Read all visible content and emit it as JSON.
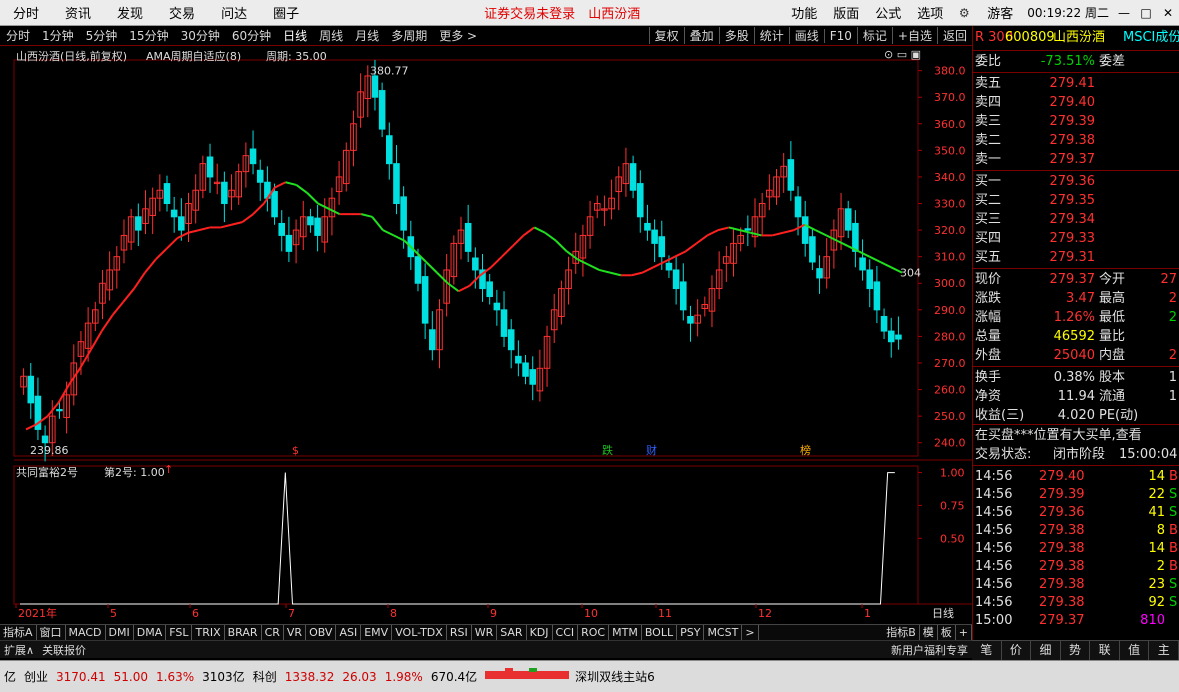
{
  "menu": {
    "items": [
      "分时",
      "资讯",
      "发现",
      "交易",
      "问达",
      "圈子"
    ],
    "notice": "证券交易未登录",
    "stock_name": "山西汾酒",
    "right_items": [
      "功能",
      "版面",
      "公式",
      "选项"
    ],
    "user": "游客",
    "clock": "00:19:22 周二"
  },
  "toolbar": {
    "periods": [
      "分时",
      "1分钟",
      "5分钟",
      "15分钟",
      "30分钟",
      "60分钟",
      "日线",
      "周线",
      "月线",
      "多周期",
      "更多 >"
    ],
    "active_period": "日线",
    "buttons": [
      "复权",
      "叠加",
      "多股",
      "统计",
      "画线",
      "F10",
      "标记",
      "+自选",
      "返回"
    ]
  },
  "chart_header": {
    "title": "山西汾酒(日线,前复权)",
    "indicator": "AMA周期自适应(8)",
    "period_label": "周期: 35.00"
  },
  "sub_header": {
    "name": "共同富裕2号",
    "value_label": "第2号: 1.00",
    "arrow": "↑"
  },
  "events": [
    "$",
    "跌",
    "财",
    "榜"
  ],
  "x_labels": [
    "2021年",
    "5",
    "6",
    "7",
    "8",
    "9",
    "10",
    "11",
    "12",
    "1"
  ],
  "period_tag": "日线",
  "indicator_tabs": [
    "指标A",
    "窗口",
    "MACD",
    "DMI",
    "DMA",
    "FSL",
    "TRIX",
    "BRAR",
    "CR",
    "VR",
    "OBV",
    "ASI",
    "EMV",
    "VOL-TDX",
    "RSI",
    "WR",
    "SAR",
    "KDJ",
    "CCI",
    "ROC",
    "MTM",
    "BOLL",
    "PSY",
    "MCST",
    ">",
    "指标B",
    "模",
    "板",
    "+"
  ],
  "subtabs": [
    "扩展∧",
    "关联报价"
  ],
  "promo": "新用户福利专享",
  "right_tabs": [
    "笔",
    "价",
    "细",
    "势",
    "联",
    "值",
    "主"
  ],
  "status": {
    "items": [
      {
        "label": "创业",
        "value": "3170.41",
        "chg": "51.00",
        "pct": "1.63%",
        "amt": "3103亿"
      },
      {
        "label": "科创",
        "value": "1338.32",
        "chg": "26.03",
        "pct": "1.98%",
        "amt": "670.4亿"
      }
    ],
    "site": "深圳双线主站6",
    "prefix": "亿"
  },
  "quote": {
    "badge": "R 300",
    "code": "600809",
    "name": "山西汾酒",
    "tag": "MSCI成份",
    "weibi_label": "委比",
    "weibi": "-73.51%",
    "weicha_label": "委差",
    "asks": [
      {
        "label": "卖五",
        "price": "279.41"
      },
      {
        "label": "卖四",
        "price": "279.40"
      },
      {
        "label": "卖三",
        "price": "279.39"
      },
      {
        "label": "卖二",
        "price": "279.38"
      },
      {
        "label": "卖一",
        "price": "279.37"
      }
    ],
    "bids": [
      {
        "label": "买一",
        "price": "279.36"
      },
      {
        "label": "买二",
        "price": "279.35"
      },
      {
        "label": "买三",
        "price": "279.34"
      },
      {
        "label": "买四",
        "price": "279.33"
      },
      {
        "label": "买五",
        "price": "279.31"
      }
    ],
    "stats": [
      {
        "l1": "现价",
        "v1": "279.37",
        "l2": "今开",
        "v2": "27"
      },
      {
        "l1": "涨跌",
        "v1": "3.47",
        "l2": "最高",
        "v2": "2"
      },
      {
        "l1": "涨幅",
        "v1": "1.26%",
        "l2": "最低",
        "v2": "2"
      },
      {
        "l1": "总量",
        "v1": "46592",
        "l2": "量比",
        "v2": ""
      },
      {
        "l1": "外盘",
        "v1": "25040",
        "l2": "内盘",
        "v2": "2"
      }
    ],
    "stats2": [
      {
        "l1": "换手",
        "v1": "0.38%",
        "l2": "股本",
        "v2": "1"
      },
      {
        "l1": "净资",
        "v1": "11.94",
        "l2": "流通",
        "v2": "1"
      },
      {
        "l1": "收益(三)",
        "v1": "4.020",
        "l2": "PE(动)",
        "v2": ""
      }
    ],
    "msg": "在买盘***位置有大买单,查看",
    "trade_state_label": "交易状态:",
    "trade_state": "闭市阶段",
    "trade_time": "15:00:04",
    "ticks": [
      {
        "t": "14:56",
        "p": "279.40",
        "v": "14",
        "s": "B"
      },
      {
        "t": "14:56",
        "p": "279.39",
        "v": "22",
        "s": "S"
      },
      {
        "t": "14:56",
        "p": "279.36",
        "v": "41",
        "s": "S"
      },
      {
        "t": "14:56",
        "p": "279.38",
        "v": "8",
        "s": "B"
      },
      {
        "t": "14:56",
        "p": "279.38",
        "v": "14",
        "s": "B"
      },
      {
        "t": "14:56",
        "p": "279.38",
        "v": "2",
        "s": "B"
      },
      {
        "t": "14:56",
        "p": "279.38",
        "v": "23",
        "s": "S"
      },
      {
        "t": "14:56",
        "p": "279.38",
        "v": "92",
        "s": "S"
      },
      {
        "t": "15:00",
        "p": "279.37",
        "v": "810",
        "s": ""
      }
    ]
  },
  "chart_data": [
    {
      "type": "candlestick",
      "title": "山西汾酒(日线,前复权)",
      "indicator": "AMA周期自适应(8)",
      "y_ticks": [
        240,
        250,
        260,
        270,
        280,
        290,
        300,
        310,
        320,
        330,
        340,
        350,
        360,
        370,
        380
      ],
      "ylim": [
        235,
        384
      ],
      "x_labels": [
        "2021年",
        "5",
        "6",
        "7",
        "8",
        "9",
        "10",
        "11",
        "12",
        "1"
      ],
      "annotations": [
        {
          "text": "380.77",
          "kind": "high"
        },
        {
          "text": "239.86",
          "kind": "low"
        },
        {
          "text": "304",
          "kind": "ama_last"
        }
      ],
      "close": [
        265,
        255,
        245,
        240,
        250,
        252,
        258,
        270,
        278,
        285,
        290,
        300,
        305,
        310,
        318,
        325,
        320,
        328,
        332,
        335,
        330,
        325,
        320,
        330,
        335,
        345,
        340,
        338,
        330,
        335,
        342,
        348,
        345,
        338,
        332,
        325,
        318,
        312,
        320,
        325,
        322,
        318,
        325,
        332,
        340,
        350,
        360,
        372,
        378,
        370,
        358,
        345,
        330,
        320,
        310,
        300,
        285,
        275,
        290,
        305,
        315,
        320,
        312,
        305,
        298,
        295,
        290,
        280,
        275,
        270,
        265,
        262,
        268,
        280,
        290,
        298,
        305,
        312,
        318,
        325,
        330,
        328,
        332,
        340,
        345,
        335,
        325,
        320,
        315,
        310,
        305,
        298,
        290,
        285,
        288,
        292,
        298,
        305,
        310,
        315,
        318,
        320,
        325,
        330,
        335,
        340,
        344,
        335,
        325,
        315,
        308,
        302,
        310,
        320,
        328,
        320,
        312,
        305,
        298,
        290,
        282,
        278,
        279
      ],
      "ama": [
        245,
        247,
        250,
        255,
        262,
        268,
        275,
        282,
        288,
        293,
        298,
        304,
        309,
        313,
        317,
        319,
        320,
        321,
        321,
        322,
        323,
        326,
        330,
        336,
        338,
        337,
        334,
        330,
        328,
        326,
        326,
        326,
        325,
        320,
        318,
        316,
        312,
        308,
        304,
        300,
        297,
        299,
        303,
        306,
        310,
        314,
        318,
        321,
        319,
        316,
        312,
        309,
        307,
        305,
        304,
        303,
        303,
        304,
        306,
        308,
        310,
        312,
        315,
        318,
        320,
        321,
        320,
        319,
        318,
        318,
        319,
        320,
        322,
        320,
        318,
        316,
        314,
        312,
        310,
        308,
        306,
        304
      ]
    },
    {
      "type": "line",
      "title": "共同富裕2号",
      "series": [
        {
          "name": "第2号",
          "values": [
            0,
            0,
            0,
            0,
            0,
            0,
            0,
            0,
            0,
            0,
            0,
            0,
            0,
            0,
            0,
            0,
            0,
            0,
            0,
            0,
            0,
            0,
            0,
            0,
            0,
            0,
            0,
            0,
            0,
            0,
            0,
            0,
            0,
            0,
            0,
            0,
            0,
            1,
            0,
            0,
            0,
            0,
            0,
            0,
            0,
            0,
            0,
            0,
            0,
            0,
            0,
            0,
            0,
            0,
            0,
            0,
            0,
            0,
            0,
            0,
            0,
            0,
            0,
            0,
            0,
            0,
            0,
            0,
            0,
            0,
            0,
            0,
            0,
            0,
            0,
            0,
            0,
            0,
            0,
            0,
            0,
            0,
            0,
            0,
            0,
            0,
            0,
            0,
            0,
            0,
            0,
            0,
            0,
            0,
            0,
            0,
            0,
            0,
            0,
            0,
            0,
            0,
            0,
            0,
            0,
            0,
            0,
            0,
            0,
            0,
            0,
            0,
            0,
            0,
            0,
            0,
            0,
            0,
            0,
            0,
            0,
            1,
            1
          ]
        }
      ],
      "y_ticks": [
        0.5,
        0.75,
        1.0
      ],
      "ylim": [
        0,
        1.05
      ]
    }
  ]
}
